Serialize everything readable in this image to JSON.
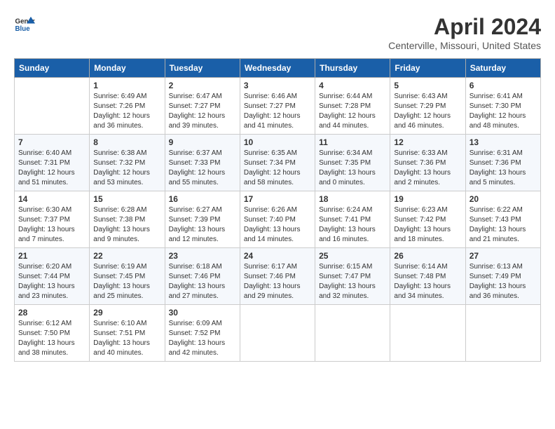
{
  "header": {
    "logo_line1": "General",
    "logo_line2": "Blue",
    "month": "April 2024",
    "location": "Centerville, Missouri, United States"
  },
  "weekdays": [
    "Sunday",
    "Monday",
    "Tuesday",
    "Wednesday",
    "Thursday",
    "Friday",
    "Saturday"
  ],
  "weeks": [
    [
      {
        "day": "",
        "sunrise": "",
        "sunset": "",
        "daylight": ""
      },
      {
        "day": "1",
        "sunrise": "Sunrise: 6:49 AM",
        "sunset": "Sunset: 7:26 PM",
        "daylight": "Daylight: 12 hours and 36 minutes."
      },
      {
        "day": "2",
        "sunrise": "Sunrise: 6:47 AM",
        "sunset": "Sunset: 7:27 PM",
        "daylight": "Daylight: 12 hours and 39 minutes."
      },
      {
        "day": "3",
        "sunrise": "Sunrise: 6:46 AM",
        "sunset": "Sunset: 7:27 PM",
        "daylight": "Daylight: 12 hours and 41 minutes."
      },
      {
        "day": "4",
        "sunrise": "Sunrise: 6:44 AM",
        "sunset": "Sunset: 7:28 PM",
        "daylight": "Daylight: 12 hours and 44 minutes."
      },
      {
        "day": "5",
        "sunrise": "Sunrise: 6:43 AM",
        "sunset": "Sunset: 7:29 PM",
        "daylight": "Daylight: 12 hours and 46 minutes."
      },
      {
        "day": "6",
        "sunrise": "Sunrise: 6:41 AM",
        "sunset": "Sunset: 7:30 PM",
        "daylight": "Daylight: 12 hours and 48 minutes."
      }
    ],
    [
      {
        "day": "7",
        "sunrise": "Sunrise: 6:40 AM",
        "sunset": "Sunset: 7:31 PM",
        "daylight": "Daylight: 12 hours and 51 minutes."
      },
      {
        "day": "8",
        "sunrise": "Sunrise: 6:38 AM",
        "sunset": "Sunset: 7:32 PM",
        "daylight": "Daylight: 12 hours and 53 minutes."
      },
      {
        "day": "9",
        "sunrise": "Sunrise: 6:37 AM",
        "sunset": "Sunset: 7:33 PM",
        "daylight": "Daylight: 12 hours and 55 minutes."
      },
      {
        "day": "10",
        "sunrise": "Sunrise: 6:35 AM",
        "sunset": "Sunset: 7:34 PM",
        "daylight": "Daylight: 12 hours and 58 minutes."
      },
      {
        "day": "11",
        "sunrise": "Sunrise: 6:34 AM",
        "sunset": "Sunset: 7:35 PM",
        "daylight": "Daylight: 13 hours and 0 minutes."
      },
      {
        "day": "12",
        "sunrise": "Sunrise: 6:33 AM",
        "sunset": "Sunset: 7:36 PM",
        "daylight": "Daylight: 13 hours and 2 minutes."
      },
      {
        "day": "13",
        "sunrise": "Sunrise: 6:31 AM",
        "sunset": "Sunset: 7:36 PM",
        "daylight": "Daylight: 13 hours and 5 minutes."
      }
    ],
    [
      {
        "day": "14",
        "sunrise": "Sunrise: 6:30 AM",
        "sunset": "Sunset: 7:37 PM",
        "daylight": "Daylight: 13 hours and 7 minutes."
      },
      {
        "day": "15",
        "sunrise": "Sunrise: 6:28 AM",
        "sunset": "Sunset: 7:38 PM",
        "daylight": "Daylight: 13 hours and 9 minutes."
      },
      {
        "day": "16",
        "sunrise": "Sunrise: 6:27 AM",
        "sunset": "Sunset: 7:39 PM",
        "daylight": "Daylight: 13 hours and 12 minutes."
      },
      {
        "day": "17",
        "sunrise": "Sunrise: 6:26 AM",
        "sunset": "Sunset: 7:40 PM",
        "daylight": "Daylight: 13 hours and 14 minutes."
      },
      {
        "day": "18",
        "sunrise": "Sunrise: 6:24 AM",
        "sunset": "Sunset: 7:41 PM",
        "daylight": "Daylight: 13 hours and 16 minutes."
      },
      {
        "day": "19",
        "sunrise": "Sunrise: 6:23 AM",
        "sunset": "Sunset: 7:42 PM",
        "daylight": "Daylight: 13 hours and 18 minutes."
      },
      {
        "day": "20",
        "sunrise": "Sunrise: 6:22 AM",
        "sunset": "Sunset: 7:43 PM",
        "daylight": "Daylight: 13 hours and 21 minutes."
      }
    ],
    [
      {
        "day": "21",
        "sunrise": "Sunrise: 6:20 AM",
        "sunset": "Sunset: 7:44 PM",
        "daylight": "Daylight: 13 hours and 23 minutes."
      },
      {
        "day": "22",
        "sunrise": "Sunrise: 6:19 AM",
        "sunset": "Sunset: 7:45 PM",
        "daylight": "Daylight: 13 hours and 25 minutes."
      },
      {
        "day": "23",
        "sunrise": "Sunrise: 6:18 AM",
        "sunset": "Sunset: 7:46 PM",
        "daylight": "Daylight: 13 hours and 27 minutes."
      },
      {
        "day": "24",
        "sunrise": "Sunrise: 6:17 AM",
        "sunset": "Sunset: 7:46 PM",
        "daylight": "Daylight: 13 hours and 29 minutes."
      },
      {
        "day": "25",
        "sunrise": "Sunrise: 6:15 AM",
        "sunset": "Sunset: 7:47 PM",
        "daylight": "Daylight: 13 hours and 32 minutes."
      },
      {
        "day": "26",
        "sunrise": "Sunrise: 6:14 AM",
        "sunset": "Sunset: 7:48 PM",
        "daylight": "Daylight: 13 hours and 34 minutes."
      },
      {
        "day": "27",
        "sunrise": "Sunrise: 6:13 AM",
        "sunset": "Sunset: 7:49 PM",
        "daylight": "Daylight: 13 hours and 36 minutes."
      }
    ],
    [
      {
        "day": "28",
        "sunrise": "Sunrise: 6:12 AM",
        "sunset": "Sunset: 7:50 PM",
        "daylight": "Daylight: 13 hours and 38 minutes."
      },
      {
        "day": "29",
        "sunrise": "Sunrise: 6:10 AM",
        "sunset": "Sunset: 7:51 PM",
        "daylight": "Daylight: 13 hours and 40 minutes."
      },
      {
        "day": "30",
        "sunrise": "Sunrise: 6:09 AM",
        "sunset": "Sunset: 7:52 PM",
        "daylight": "Daylight: 13 hours and 42 minutes."
      },
      {
        "day": "",
        "sunrise": "",
        "sunset": "",
        "daylight": ""
      },
      {
        "day": "",
        "sunrise": "",
        "sunset": "",
        "daylight": ""
      },
      {
        "day": "",
        "sunrise": "",
        "sunset": "",
        "daylight": ""
      },
      {
        "day": "",
        "sunrise": "",
        "sunset": "",
        "daylight": ""
      }
    ]
  ]
}
